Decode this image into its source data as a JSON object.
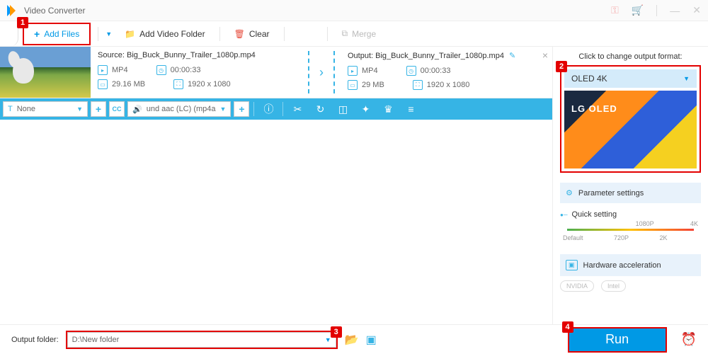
{
  "titlebar": {
    "title": "Video Converter"
  },
  "toolbar": {
    "add_files": "Add Files",
    "add_folder": "Add Video Folder",
    "clear": "Clear",
    "merge": "Merge"
  },
  "file": {
    "source_label": "Source:",
    "source_name": "Big_Buck_Bunny_Trailer_1080p.mp4",
    "output_label": "Output:",
    "output_name": "Big_Buck_Bunny_Trailer_1080p.mp4",
    "src": {
      "format": "MP4",
      "duration": "00:00:33",
      "size": "29.16 MB",
      "resolution": "1920 x 1080"
    },
    "out": {
      "format": "MP4",
      "duration": "00:00:33",
      "size": "29 MB",
      "resolution": "1920 x 1080"
    }
  },
  "actionbar": {
    "subtitle": "None",
    "audio": "und aac (LC) (mp4a"
  },
  "side": {
    "title": "Click to change output format:",
    "format": "OLED 4K",
    "tv_brand": "LG OLED",
    "param_settings": "Parameter settings",
    "quick_setting": "Quick setting",
    "quality_top": [
      "1080P",
      "4K"
    ],
    "quality_bot": [
      "Default",
      "720P",
      "2K"
    ],
    "hw_accel": "Hardware acceleration",
    "nvidia": "NVIDIA",
    "intel": "Intel"
  },
  "footer": {
    "label": "Output folder:",
    "path": "D:\\New folder",
    "run": "Run"
  },
  "markers": {
    "m1": "1",
    "m2": "2",
    "m3": "3",
    "m4": "4"
  }
}
